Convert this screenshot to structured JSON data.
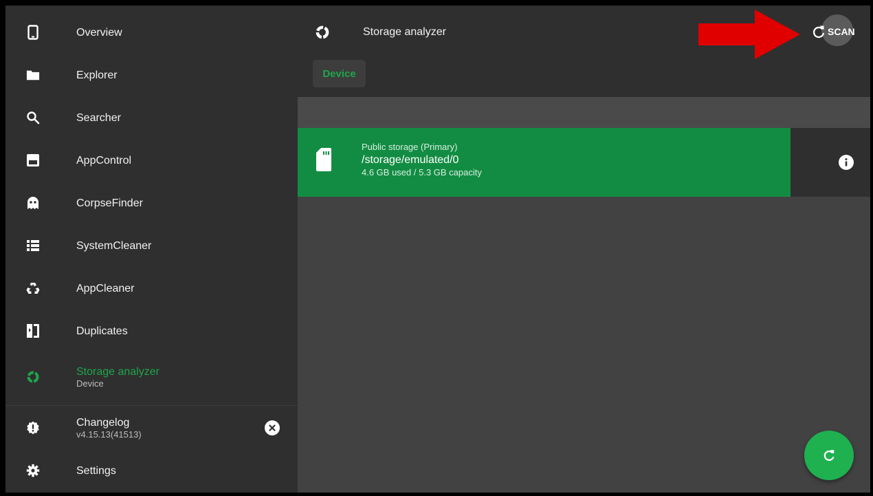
{
  "colors": {
    "accent": "#1ea64a",
    "card": "#138c43",
    "sidebar_bg": "#2f2f2f",
    "main_bg": "#424242",
    "arrow": "#e00000"
  },
  "sidebar": {
    "items": [
      {
        "label": "Overview",
        "icon": "phone-icon"
      },
      {
        "label": "Explorer",
        "icon": "folder-icon"
      },
      {
        "label": "Searcher",
        "icon": "search-icon"
      },
      {
        "label": "AppControl",
        "icon": "app-window-icon"
      },
      {
        "label": "CorpseFinder",
        "icon": "ghost-icon"
      },
      {
        "label": "SystemCleaner",
        "icon": "list-icon"
      },
      {
        "label": "AppCleaner",
        "icon": "recycle-icon"
      },
      {
        "label": "Duplicates",
        "icon": "duplicates-icon"
      },
      {
        "label": "Storage analyzer",
        "sub": "Device",
        "icon": "storage-analyzer-icon",
        "active": true
      }
    ],
    "changelog": {
      "label": "Changelog",
      "version": "v4.15.13(41513)",
      "icon": "badge-alert-icon"
    },
    "settings": {
      "label": "Settings",
      "icon": "gear-icon"
    }
  },
  "header": {
    "title": "Storage analyzer",
    "scan_label": "SCAN",
    "tabs": [
      {
        "label": "Device",
        "selected": true
      }
    ]
  },
  "storage": {
    "type": "Public storage (Primary)",
    "path": "/storage/emulated/0",
    "usage": "4.6 GB used / 5.3 GB capacity"
  }
}
